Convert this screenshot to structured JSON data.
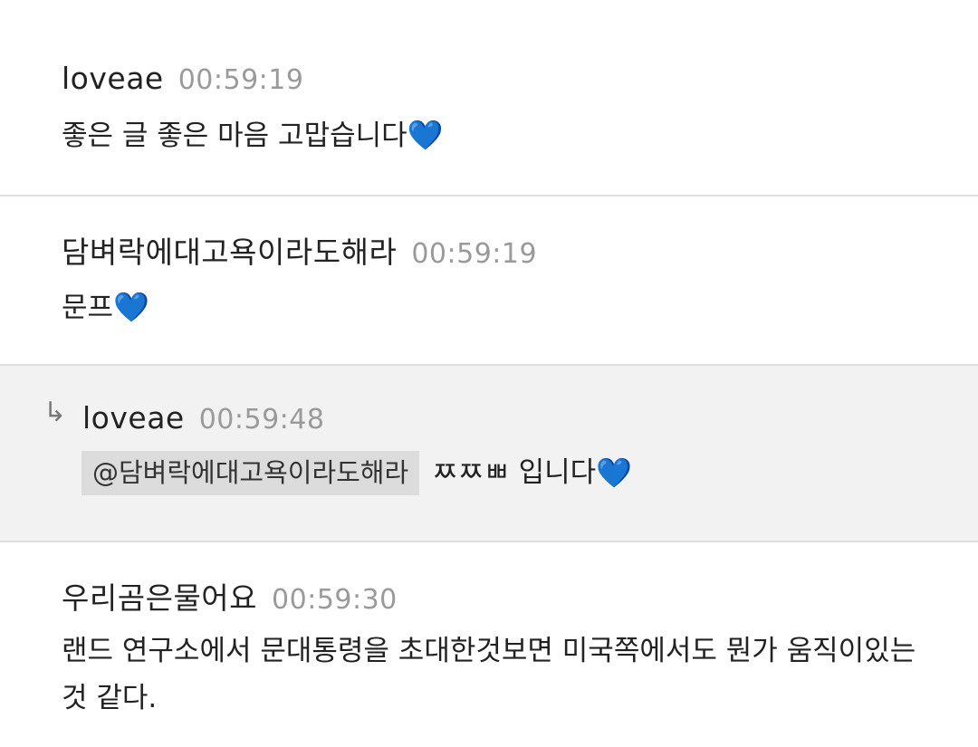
{
  "comments": [
    {
      "author": "loveae",
      "time": "00:59:19",
      "text": "좋은 글 좋은 마음 고맙습니다",
      "emoji": "💙"
    },
    {
      "author": "담벼락에대고욕이라도해라",
      "time": "00:59:19",
      "text": "문프",
      "emoji": "💙"
    },
    {
      "reply_icon": "↳",
      "author": "loveae",
      "time": "00:59:48",
      "mention": "@담벼락에대고욕이라도해라",
      "text": "ㅉㅉㅃ 입니다",
      "emoji": "💙"
    },
    {
      "author": "우리곰은물어요",
      "time": "00:59:30",
      "text": "랜드 연구소에서 문대통령을 초대한것보면 미국쪽에서도 뭔가 움직이있는것 같다."
    }
  ],
  "colors": {
    "divider": "#dedede",
    "reply_background": "#f2f2f2",
    "mention_background": "#dcdcdc",
    "timestamp": "#9a9a9a"
  },
  "icons": {
    "reply": "reply-arrow-icon",
    "heart": "blue-heart-icon"
  }
}
